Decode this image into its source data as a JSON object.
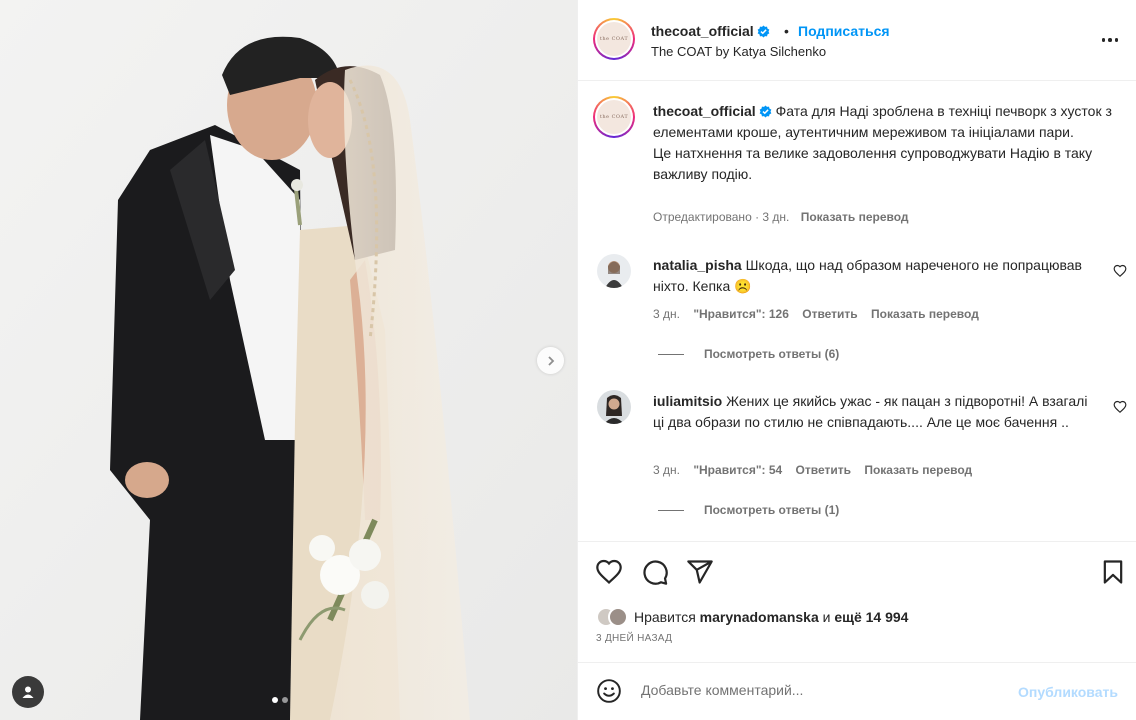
{
  "header": {
    "username": "thecoat_official",
    "bullet": "•",
    "follow_label": "Подписаться",
    "subtitle": "The COAT by Katya Silchenko",
    "avatar_text": "the COAT"
  },
  "caption": {
    "username": "thecoat_official",
    "text_line1": "Фата для Наді зроблена в техніці печворк з хусток з елементами кроше, аутентичним мереживом та ініціалами пари.",
    "text_line2": "Це натхнення та велике задоволення супроводжувати Надію в таку важливу подію.",
    "edited": "Отредактировано · 3 дн.",
    "translate": "Показать перевод"
  },
  "comments": [
    {
      "username": "natalia_pisha",
      "text": "Шкода, що над образом нареченого не попрацював ніхто. Кепка ☹️",
      "time": "3 дн.",
      "likes": "\"Нравится\": 126",
      "reply": "Ответить",
      "translate": "Показать перевод",
      "view_replies": "Посмотреть ответы (6)"
    },
    {
      "username": "iuliamitsio",
      "text": "Жених це якийсь ужас - як пацан з підворотні! А взагалі ці два образи по стилю не співпадають.... Але це моє бачення ..",
      "time": "3 дн.",
      "likes": "\"Нравится\": 54",
      "reply": "Ответить",
      "translate": "Показать перевод",
      "view_replies": "Посмотреть ответы (1)"
    }
  ],
  "likes": {
    "prefix": "Нравится",
    "user": "marynadomanska",
    "and": "и",
    "others": "ещё 14 994"
  },
  "date": "3 дней назад",
  "comment_box": {
    "placeholder": "Добавьте комментарий...",
    "post_label": "Опубликовать"
  },
  "icons": [
    "verified-icon",
    "more-icon",
    "heart-icon",
    "comment-icon",
    "share-icon",
    "bookmark-icon",
    "emoji-icon",
    "chevron-right-icon",
    "user-icon"
  ],
  "colors": {
    "accent": "#0095f6",
    "text": "#262626",
    "muted": "#737373",
    "post_disabled": "#b3dbff"
  },
  "carousel": {
    "total": 2,
    "active": 1
  }
}
